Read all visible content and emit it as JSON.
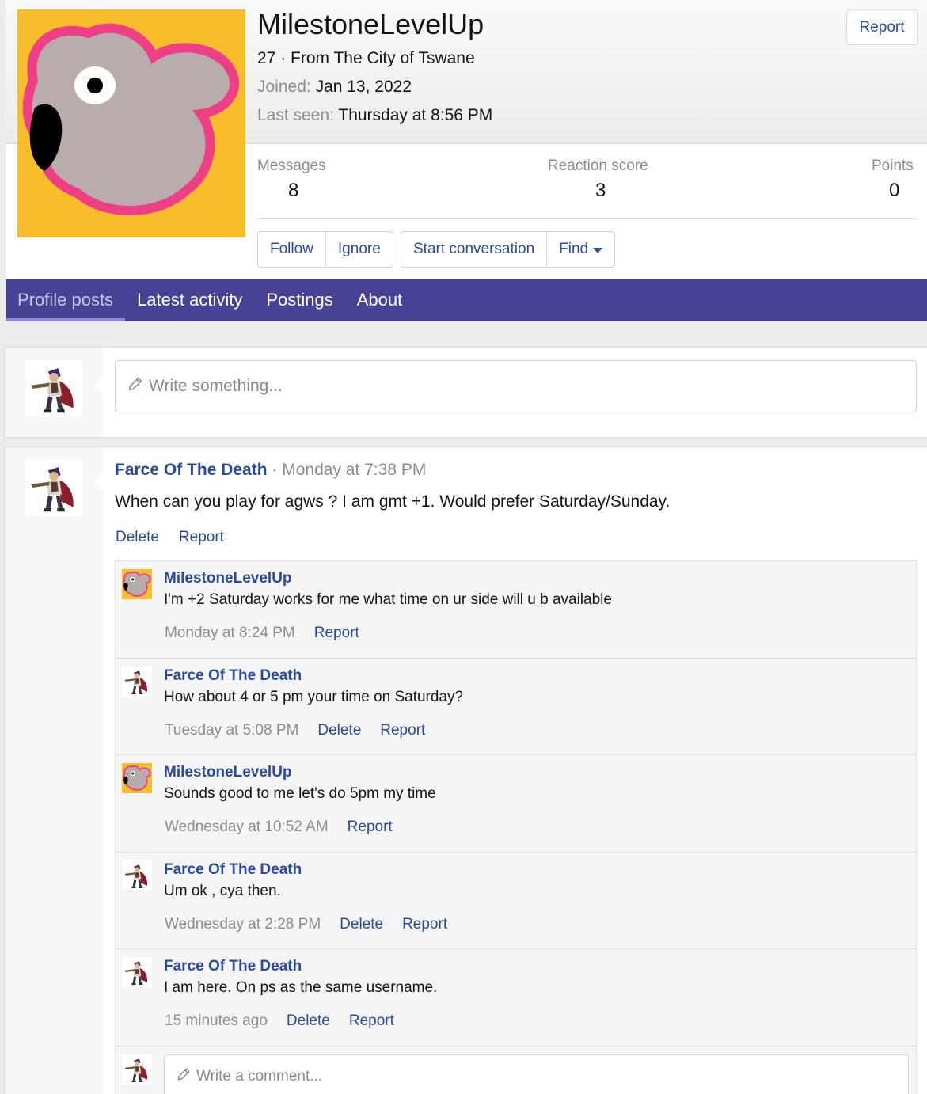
{
  "profile": {
    "username": "MilestoneLevelUp",
    "subtitle": "27 · From The City of Tswane",
    "joined_label": "Joined:",
    "joined_value": "Jan 13, 2022",
    "last_seen_label": "Last seen:",
    "last_seen_value": "Thursday at 8:56 PM",
    "report_label": "Report"
  },
  "stats": {
    "messages_label": "Messages",
    "messages_value": "8",
    "reaction_label": "Reaction score",
    "reaction_value": "3",
    "points_label": "Points",
    "points_value": "0"
  },
  "actions": {
    "follow": "Follow",
    "ignore": "Ignore",
    "start_conversation": "Start conversation",
    "find": "Find"
  },
  "tabs": [
    "Profile posts",
    "Latest activity",
    "Postings",
    "About"
  ],
  "write": {
    "placeholder": "Write something..."
  },
  "post": {
    "author": "Farce Of The Death",
    "separator": " · ",
    "time": "Monday at 7:38 PM",
    "text": "When can you play for agws ? I am gmt +1. Would prefer Saturday/Sunday.",
    "delete": "Delete",
    "report": "Report"
  },
  "comments": [
    {
      "author": "MilestoneLevelUp",
      "text": "I'm +2 Saturday works for me what time on ur side will u b available",
      "time": "Monday at 8:24 PM",
      "delete": "",
      "report": "Report",
      "avatar": "dodo"
    },
    {
      "author": "Farce Of The Death",
      "text": "How about 4 or 5 pm your time on Saturday?",
      "time": "Tuesday at 5:08 PM",
      "delete": "Delete",
      "report": "Report",
      "avatar": "warrior"
    },
    {
      "author": "MilestoneLevelUp",
      "text": "Sounds good to me let's do 5pm my time",
      "time": "Wednesday at 10:52 AM",
      "delete": "",
      "report": "Report",
      "avatar": "dodo"
    },
    {
      "author": "Farce Of The Death",
      "text": "Um ok , cya then.",
      "time": "Wednesday at 2:28 PM",
      "delete": "Delete",
      "report": "Report",
      "avatar": "warrior"
    },
    {
      "author": "Farce Of The Death",
      "text": "I am here. On ps as the same username.",
      "time": "15 minutes ago",
      "delete": "Delete",
      "report": "Report",
      "avatar": "warrior"
    }
  ],
  "comment_write": {
    "placeholder": "Write a comment..."
  }
}
